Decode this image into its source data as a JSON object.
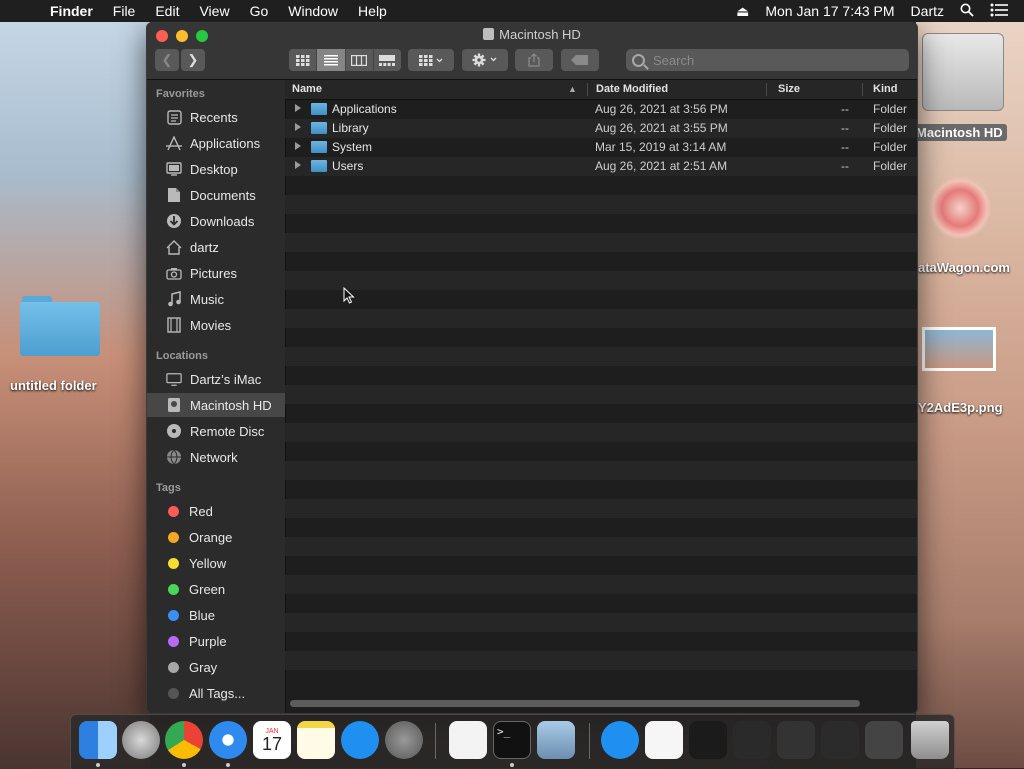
{
  "menubar": {
    "app": "Finder",
    "items": [
      "File",
      "Edit",
      "View",
      "Go",
      "Window",
      "Help"
    ],
    "datetime": "Mon Jan 17  7:43 PM",
    "user": "Dartz"
  },
  "desktop": {
    "folder_label": "untitled folder",
    "hd_label": "Macintosh HD",
    "datawagon_label": "ataWagon.com",
    "png_label": "Y2AdE3p.png"
  },
  "window": {
    "title": "Macintosh HD",
    "search_placeholder": "Search"
  },
  "sidebar": {
    "favorites_heading": "Favorites",
    "favorites": [
      {
        "label": "Recents",
        "icon": "clock-icon"
      },
      {
        "label": "Applications",
        "icon": "applications-icon"
      },
      {
        "label": "Desktop",
        "icon": "desktop-icon"
      },
      {
        "label": "Documents",
        "icon": "documents-icon"
      },
      {
        "label": "Downloads",
        "icon": "downloads-icon"
      },
      {
        "label": "dartz",
        "icon": "home-icon"
      },
      {
        "label": "Pictures",
        "icon": "camera-icon"
      },
      {
        "label": "Music",
        "icon": "music-icon"
      },
      {
        "label": "Movies",
        "icon": "film-icon"
      }
    ],
    "locations_heading": "Locations",
    "locations": [
      {
        "label": "Dartz’s iMac",
        "icon": "imac-icon"
      },
      {
        "label": "Macintosh HD",
        "icon": "harddrive-icon",
        "selected": true
      },
      {
        "label": "Remote Disc",
        "icon": "disc-icon"
      },
      {
        "label": "Network",
        "icon": "globe-icon"
      }
    ],
    "tags_heading": "Tags",
    "tags": [
      {
        "label": "Red",
        "color": "#fc5b57"
      },
      {
        "label": "Orange",
        "color": "#f5a623"
      },
      {
        "label": "Yellow",
        "color": "#f6dd31"
      },
      {
        "label": "Green",
        "color": "#4ad556"
      },
      {
        "label": "Blue",
        "color": "#3a8ef6"
      },
      {
        "label": "Purple",
        "color": "#b56bf2"
      },
      {
        "label": "Gray",
        "color": "#a7a7a7"
      },
      {
        "label": "All Tags...",
        "color": "#555555"
      }
    ]
  },
  "list": {
    "columns": {
      "name": "Name",
      "date": "Date Modified",
      "size": "Size",
      "kind": "Kind"
    },
    "rows": [
      {
        "name": "Applications",
        "date": "Aug 26, 2021 at 3:56 PM",
        "size": "--",
        "kind": "Folder"
      },
      {
        "name": "Library",
        "date": "Aug 26, 2021 at 3:55 PM",
        "size": "--",
        "kind": "Folder"
      },
      {
        "name": "System",
        "date": "Mar 15, 2019 at 3:14 AM",
        "size": "--",
        "kind": "Folder"
      },
      {
        "name": "Users",
        "date": "Aug 26, 2021 at 2:51 AM",
        "size": "--",
        "kind": "Folder"
      }
    ]
  },
  "dock": {
    "apps": [
      "Finder",
      "Launchpad",
      "Chrome",
      "Safari",
      "Calendar",
      "Notes",
      "App Store",
      "System Preferences",
      "TextEdit",
      "Terminal",
      "Preview",
      "App Store Installer",
      "Document",
      "Window 1",
      "Window 2",
      "Window 3",
      "Window 4",
      "Window 5",
      "Trash"
    ],
    "calendar_month": "JAN",
    "calendar_day": "17"
  }
}
